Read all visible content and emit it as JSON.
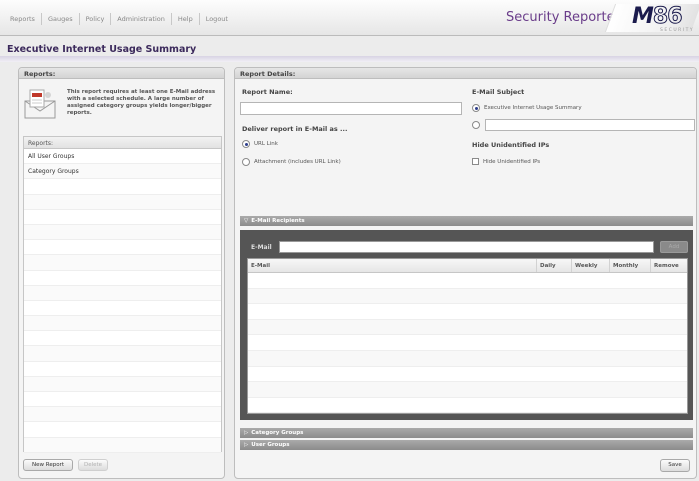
{
  "nav": {
    "items": [
      "Reports",
      "Gauges",
      "Policy",
      "Administration",
      "Help",
      "Logout"
    ],
    "app_title": "Security Reporter",
    "logo_main": "M",
    "logo_hollow": "86",
    "logo_sub": "SECURITY"
  },
  "page": {
    "title": "Executive Internet Usage Summary"
  },
  "left": {
    "header": "Reports:",
    "info_text": "This report requires at least one E-Mail address with a selected schedule. A large number of assigned category groups yields longer/bigger reports.",
    "list_header": "Reports:",
    "items": [
      "All User Groups",
      "Category Groups"
    ],
    "new_report": "New Report",
    "delete": "Delete"
  },
  "right": {
    "header": "Report Details:",
    "report_name_label": "Report Name:",
    "report_name_value": "",
    "deliver_label": "Deliver report in E-Mail as ...",
    "deliver_options": [
      "URL Link",
      "Attachment (includes URL Link)"
    ],
    "deliver_selected": 0,
    "subject_label": "E-Mail Subject",
    "subject_option": "Executive Internet Usage Summary",
    "subject_custom_value": "",
    "hide_label": "Hide Unidentified IPs",
    "hide_option": "Hide Unidentified IPs",
    "hide_checked": false,
    "recipients_title": "E-Mail Recipients",
    "email_label": "E-Mail",
    "email_value": "",
    "add": "Add",
    "columns": [
      "E-Mail",
      "Daily",
      "Weekly",
      "Monthly",
      "Remove"
    ],
    "category_groups": "Category Groups",
    "user_groups": "User Groups",
    "save": "Save"
  }
}
